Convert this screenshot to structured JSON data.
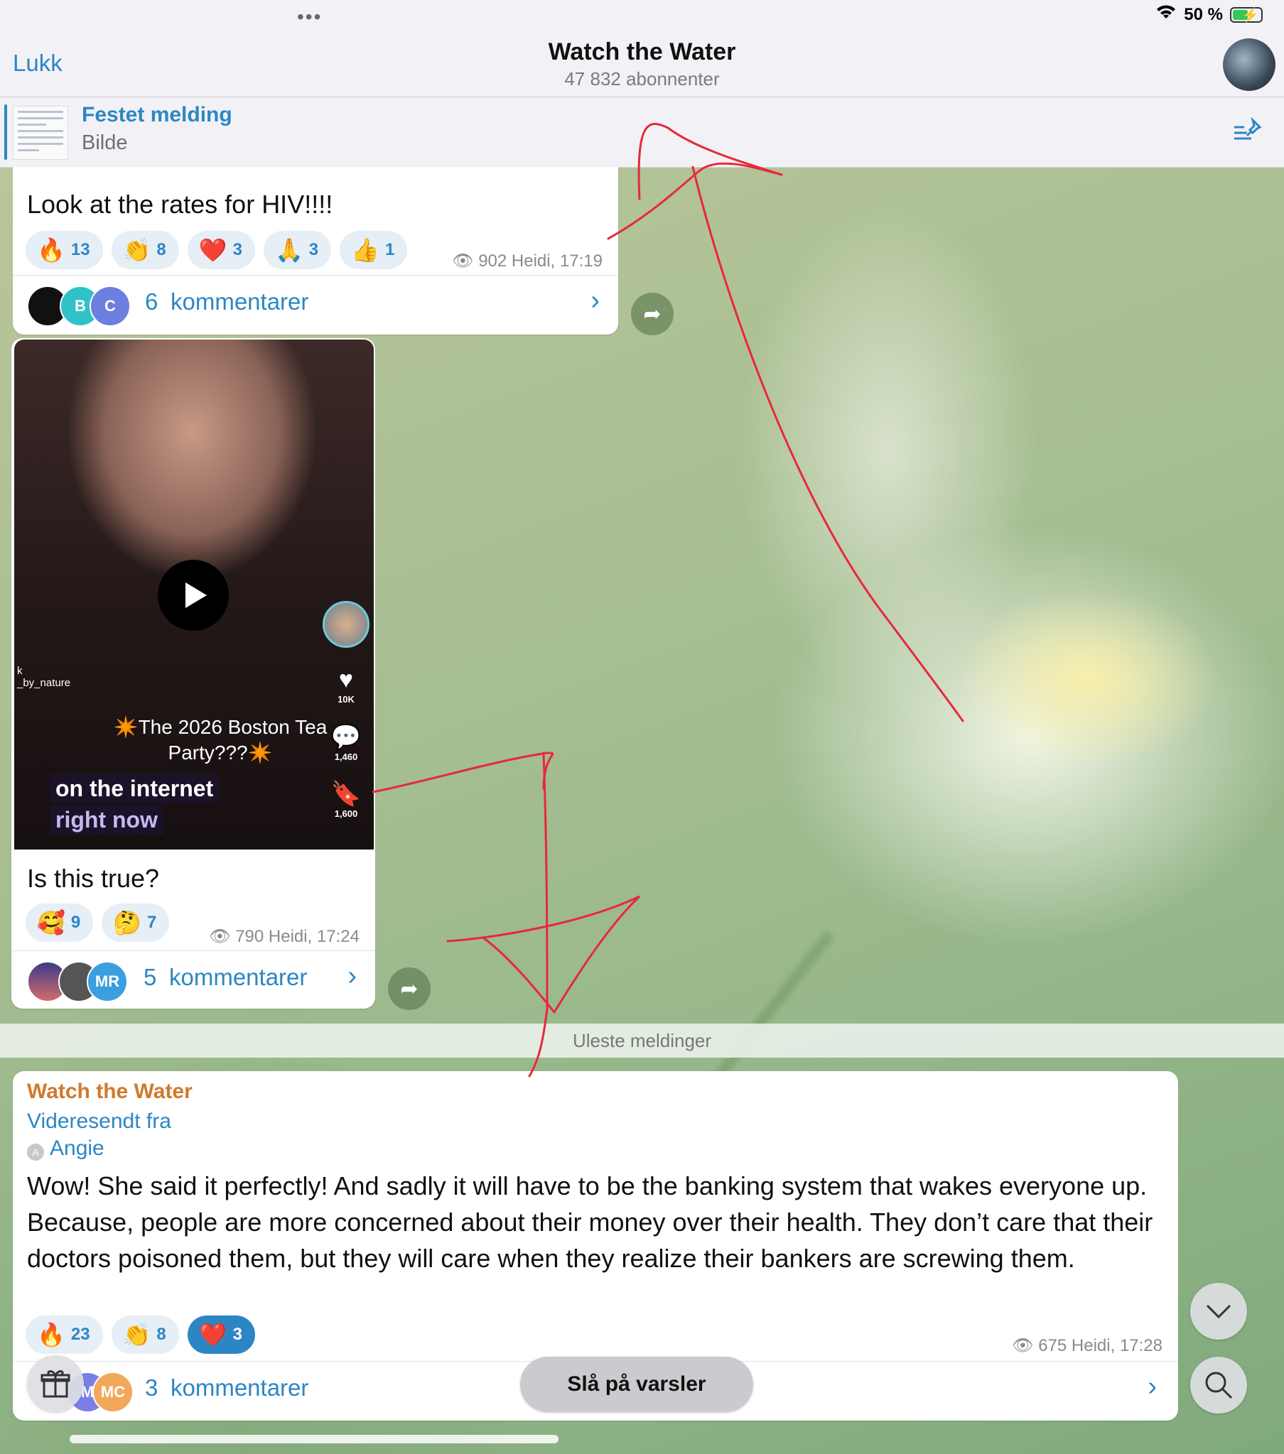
{
  "status_bar": {
    "dots": "•••",
    "battery_text": "50 %",
    "battery_level": 0.5
  },
  "header": {
    "close_label": "Lukk",
    "title": "Watch the Water",
    "subtitle": "47 832 abonnenter"
  },
  "pinned": {
    "title": "Festet melding",
    "subtitle": "Bilde"
  },
  "messages": [
    {
      "text": "Look at the rates for HIV!!!!",
      "reactions": [
        {
          "emoji": "🔥",
          "count": "13"
        },
        {
          "emoji": "👏",
          "count": "8"
        },
        {
          "emoji": "❤️",
          "count": "3"
        },
        {
          "emoji": "🙏",
          "count": "3"
        },
        {
          "emoji": "👍",
          "count": "1"
        }
      ],
      "meta": "902 Heidi, 17:19",
      "comments_count": "6",
      "comments_label": "kommentarer",
      "avatars": [
        "",
        "B",
        "C"
      ]
    },
    {
      "video": {
        "username": "k\n_by_nature",
        "caption": "✴️The 2026 Boston Tea Party???✴️",
        "overlay_line1": "on the internet",
        "overlay_line2": "right now",
        "likes": "10K",
        "comments": "1,460",
        "saves": "1,600"
      },
      "text": "Is this true?",
      "reactions": [
        {
          "emoji": "🥰",
          "count": "9"
        },
        {
          "emoji": "🤔",
          "count": "7"
        }
      ],
      "meta": "790 Heidi, 17:24",
      "comments_count": "5",
      "comments_label": "kommentarer",
      "avatars": [
        "",
        "",
        "MR"
      ]
    }
  ],
  "unread_label": "Uleste meldinger",
  "forwarded": {
    "sender": "Watch the Water",
    "forwarded_from": "Videresendt fra",
    "author_initial": "A",
    "author": "Angie",
    "text": "Wow!  She said it perfectly!  And sadly it will have to be the banking system that wakes everyone up.  Because, people are more concerned about their money over their health.  They don’t care that their doctors poisoned them, but they will care when they realize their bankers are screwing them.",
    "reactions": [
      {
        "emoji": "🔥",
        "count": "23"
      },
      {
        "emoji": "👏",
        "count": "8"
      },
      {
        "emoji": "❤️",
        "count": "3",
        "active": true
      }
    ],
    "meta": "675 Heidi, 17:28",
    "comments_count": "3",
    "comments_label": "kommentarer",
    "avatars": [
      "M",
      "MC"
    ]
  },
  "notify_button": "Slå på varsler",
  "colors": {
    "accent": "#2d86c4",
    "sender": "#d07a2e",
    "annotation": "#e8283a"
  },
  "icons": [
    "wifi-icon",
    "battery-icon",
    "pin-list-icon",
    "share-icon",
    "play-icon",
    "gift-icon",
    "chevron-down-icon",
    "search-icon"
  ]
}
